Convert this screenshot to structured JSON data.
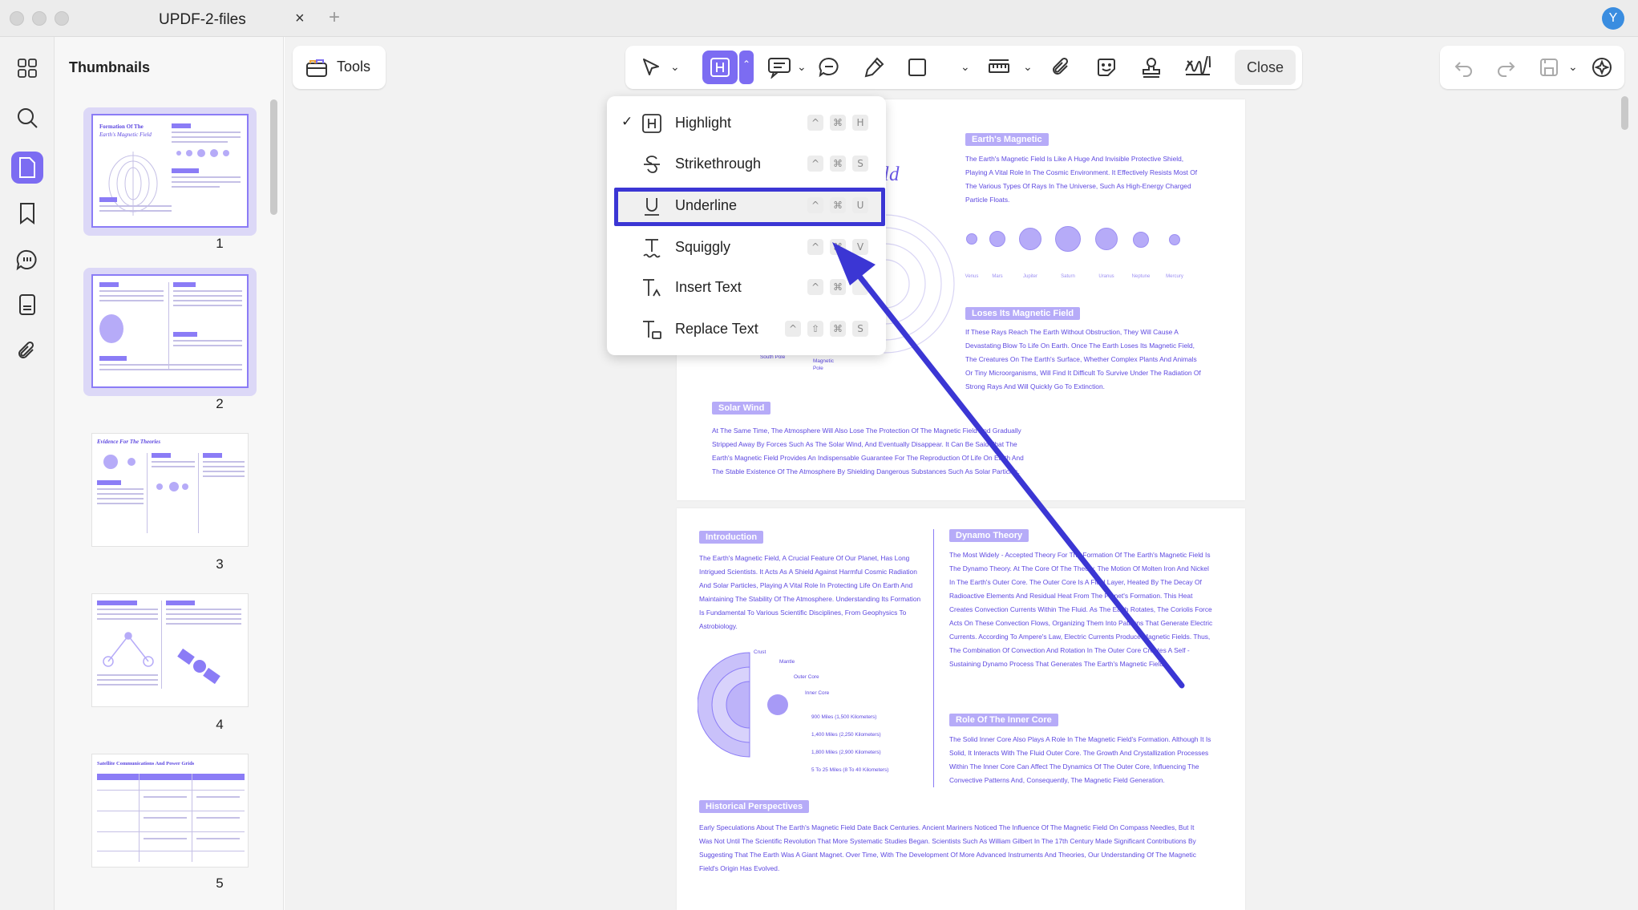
{
  "window": {
    "tab_title": "UPDF-2-files",
    "tab_close": "×",
    "new_tab": "+",
    "user_initial": "Y"
  },
  "sidebar": {
    "thumbnails_title": "Thumbnails",
    "page_numbers": [
      "1",
      "2",
      "3",
      "4",
      "5"
    ]
  },
  "toolbar": {
    "tools_label": "Tools",
    "close_label": "Close"
  },
  "dropdown": {
    "items": [
      {
        "label": "Highlight",
        "checked": true,
        "keys": [
          "^",
          "⌘",
          "H"
        ]
      },
      {
        "label": "Strikethrough",
        "checked": false,
        "keys": [
          "^",
          "⌘",
          "S"
        ]
      },
      {
        "label": "Underline",
        "checked": false,
        "keys": [
          "^",
          "⌘",
          "U"
        ]
      },
      {
        "label": "Squiggly",
        "checked": false,
        "keys": [
          "^",
          "⌘",
          "V"
        ]
      },
      {
        "label": "Insert Text",
        "checked": false,
        "keys": [
          "^",
          "⌘",
          ""
        ]
      },
      {
        "label": "Replace Text",
        "checked": false,
        "keys": [
          "^",
          "⇧",
          "⌘",
          "S"
        ]
      }
    ],
    "check_mark": "✓"
  },
  "page1": {
    "title_fragment": "ld",
    "earths_field_tag": "Earth's Magnetic",
    "earths_field_text": "The Earth's Magnetic Field Is Like A Huge And Invisible Protective Shield, Playing A Vital Role In The Cosmic Environment. It Effectively Resists Most Of The Various Types Of Rays In The Universe, Such As High-Energy Charged Particle Floats.",
    "planets": [
      "Venus",
      "Mars",
      "Jupiter",
      "Saturn",
      "Uranus",
      "Neptune",
      "Mercury"
    ],
    "loses_tag": "Loses Its Magnetic Field",
    "loses_text": "If These Rays Reach The Earth Without Obstruction, They Will Cause A Devastating Blow To Life On Earth. Once The Earth Loses Its Magnetic Field, The Creatures On The Earth's Surface, Whether Complex Plants And Animals Or Tiny Microorganisms, Will Find It Difficult To Survive Under The Radiation Of Strong Rays And Will Quickly Go To Extinction.",
    "solar_tag": "Solar Wind",
    "solar_text": "At The Same Time, The Atmosphere Will Also Lose The Protection Of The Magnetic Field And Gradually Stripped Away By Forces Such As The Solar Wind, And Eventually Disappear. It Can Be Said That The Earth's Magnetic Field Provides An Indispensable Guarantee For The Reproduction Of Life On Earth And The Stable Existence Of The Atmosphere By Shielding Dangerous Substances Such As Solar Particles.",
    "south_pole": "South Pole",
    "magnetic_pole": "Magnetic Pole"
  },
  "page2": {
    "intro_tag": "Introduction",
    "intro_text": "The Earth's Magnetic Field, A Crucial Feature Of Our Planet, Has Long Intrigued Scientists. It Acts As A Shield Against Harmful Cosmic Radiation And Solar Particles, Playing A Vital Role In Protecting Life On Earth And Maintaining The Stability Of The Atmosphere. Understanding Its Formation Is Fundamental To Various Scientific Disciplines, From Geophysics To Astrobiology.",
    "dynamo_tag": "Dynamo Theory",
    "dynamo_text": "The Most Widely - Accepted Theory For The Formation Of The Earth's Magnetic Field Is The Dynamo Theory. At The Core Of The Theory, The Motion Of Molten Iron And Nickel In The Earth's Outer Core. The Outer Core Is A Fluid Layer, Heated By The Decay Of Radioactive Elements And Residual Heat From The Planet's Formation. This Heat Creates Convection Currents Within The Fluid. As The Earth Rotates, The Coriolis Force Acts On These Convection Flows, Organizing Them Into Patterns That Generate Electric Currents. According To Ampere's Law, Electric Currents Produce Magnetic Fields. Thus, The Combination Of Convection And Rotation In The Outer Core Creates A Self - Sustaining Dynamo Process That Generates The Earth's Magnetic Field.",
    "inner_core_tag": "Role Of The Inner Core",
    "inner_core_text": "The Solid Inner Core Also Plays A Role In The Magnetic Field's Formation. Although It Is Solid, It Interacts With The Fluid Outer Core. The Growth And Crystallization Processes Within The Inner Core Can Affect The Dynamics Of The Outer Core, Influencing The Convective Patterns And, Consequently, The Magnetic Field Generation.",
    "historical_tag": "Historical Perspectives",
    "historical_text": "Early Speculations About The Earth's Magnetic Field Date Back Centuries. Ancient Mariners Noticed The Influence Of The Magnetic Field On Compass Needles, But It Was Not Until The Scientific Revolution That More Systematic Studies Began. Scientists Such As William Gilbert In The 17th Century Made Significant Contributions By Suggesting That The Earth Was A Giant Magnet. Over Time, With The Development Of More Advanced Instruments And Theories, Our Understanding Of The Magnetic Field's Origin Has Evolved.",
    "layers": [
      "Crust",
      "Mantle",
      "Outer Core",
      "Inner Core"
    ],
    "depths": [
      "900 Miles (1,500 Kilometers)",
      "1,400 Miles (2,250 Kilometers)",
      "1,800 Miles (2,900 Kilometers)",
      "5 To 25 Miles (8 To 40 Kilometers)"
    ]
  },
  "thumbnails": {
    "t1_title": "Formation Of The",
    "t1_sub": "Earth's Magnetic Field",
    "t3_title": "Evidence For The Theories",
    "t5_title": "Satellite Communications And Power Grids"
  },
  "colors": {
    "accent": "#7c6cf2",
    "doc_text": "#5d48e0",
    "tag_bg": "#b6abf8",
    "arrow": "#3b36d4"
  }
}
